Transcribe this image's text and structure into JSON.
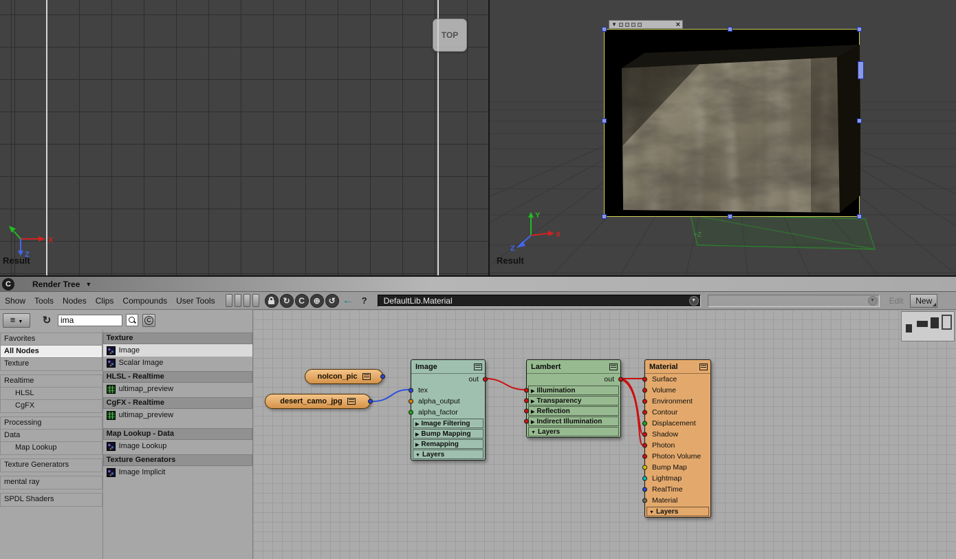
{
  "colors": {
    "accent_node_image": "#9fc0af",
    "accent_node_lambert": "#97ba90",
    "accent_node_material": "#e3a96c",
    "accent_pill": "#e4a55f",
    "wire_red": "#cc1010",
    "wire_blue": "#3050d8",
    "port_red": "#d01010",
    "port_orange": "#e08200",
    "port_green": "#18a818",
    "port_blue": "#2a48d8",
    "port_yellow": "#d8cc00",
    "port_cyan": "#00bcbc",
    "selection_yellow": "#cfcf55",
    "handle_blue": "#8b9ae0"
  },
  "icons": {
    "caret-down": "▼",
    "triangle-right": "▶",
    "triangle-down": "▼",
    "close": "×",
    "refresh": "↻",
    "history": "↺",
    "globe": "⊕",
    "menu": "≡",
    "back-arrow": "←",
    "search": "magnifier-shape",
    "lock": "padlock-shape"
  },
  "viewports": {
    "left": {
      "type_label": "TOP",
      "result_label": "Result",
      "axis": {
        "x": "X",
        "z": "Z"
      }
    },
    "right": {
      "result_label": "Result",
      "ground_label": "+Z",
      "axis": {
        "x": "X",
        "y": "Y",
        "z": "Z"
      }
    }
  },
  "panel": {
    "logo_letter": "C",
    "title": "Render Tree",
    "menus": [
      "Show",
      "Tools",
      "Nodes",
      "Clips",
      "Compounds",
      "User Tools"
    ],
    "toolbar": {
      "material_selector": "DefaultLib.Material",
      "edit_label": "Edit",
      "new_label": "New",
      "help_label": "?",
      "c_label": "C"
    },
    "search": {
      "value": "ima",
      "clear_label": "C"
    }
  },
  "sidebar": {
    "groups": [
      {
        "items": [
          {
            "label": "Favorites",
            "indent": 0,
            "selected": false
          },
          {
            "label": "All Nodes",
            "indent": 0,
            "selected": true
          },
          {
            "label": "Texture",
            "indent": 0,
            "selected": false
          }
        ]
      },
      {
        "items": [
          {
            "label": "Realtime",
            "indent": 0,
            "selected": false
          },
          {
            "label": "HLSL",
            "indent": 1,
            "selected": false
          },
          {
            "label": "CgFX",
            "indent": 1,
            "selected": false
          }
        ]
      },
      {
        "items": [
          {
            "label": "Processing",
            "indent": 0,
            "selected": false
          },
          {
            "label": "Data",
            "indent": 0,
            "selected": false
          },
          {
            "label": "Map Lookup",
            "indent": 1,
            "selected": false
          }
        ]
      },
      {
        "items": [
          {
            "label": "Texture Generators",
            "indent": 0,
            "selected": false
          }
        ]
      },
      {
        "items": [
          {
            "label": "mental ray",
            "indent": 0,
            "selected": false
          }
        ]
      },
      {
        "items": [
          {
            "label": "SPDL Shaders",
            "indent": 0,
            "selected": false
          }
        ]
      }
    ]
  },
  "nodelist": {
    "sections": [
      {
        "header": "Texture",
        "items": [
          {
            "label": "Image",
            "icon": "image-icon",
            "selected": true
          },
          {
            "label": "Scalar Image",
            "icon": "image-icon",
            "selected": false
          }
        ]
      },
      {
        "header": "HLSL - Realtime",
        "items": [
          {
            "label": "ultimap_preview",
            "icon": "realtime-icon",
            "selected": false
          }
        ]
      },
      {
        "header": "CgFX - Realtime",
        "items": [
          {
            "label": "ultimap_preview",
            "icon": "realtime-icon",
            "selected": false
          }
        ]
      },
      {
        "header": "Map Lookup - Data",
        "items": [
          {
            "label": "Image Lookup",
            "icon": "image-icon",
            "selected": false
          }
        ]
      },
      {
        "header": "Texture Generators",
        "items": [
          {
            "label": "Image Implicit",
            "icon": "image-icon",
            "selected": false
          }
        ]
      }
    ]
  },
  "graph": {
    "pills": [
      {
        "label": "noIcon_pic"
      },
      {
        "label": "desert_camo_jpg"
      }
    ],
    "image_node": {
      "title": "Image",
      "out_label": "out",
      "ports": [
        "tex",
        "alpha_output",
        "alpha_factor"
      ],
      "sections": [
        "Image Filtering",
        "Bump Mapping",
        "Remapping"
      ],
      "layers_label": "Layers"
    },
    "lambert_node": {
      "title": "Lambert",
      "out_label": "out",
      "sections": [
        "Illumination",
        "Transparency",
        "Reflection",
        "Indirect Illumination"
      ],
      "layers_label": "Layers"
    },
    "material_node": {
      "title": "Material",
      "ports": [
        "Surface",
        "Volume",
        "Environment",
        "Contour",
        "Displacement",
        "Shadow",
        "Photon",
        "Photon Volume",
        "Bump Map",
        "Lightmap",
        "RealTime",
        "Material"
      ],
      "layers_label": "Layers"
    }
  }
}
